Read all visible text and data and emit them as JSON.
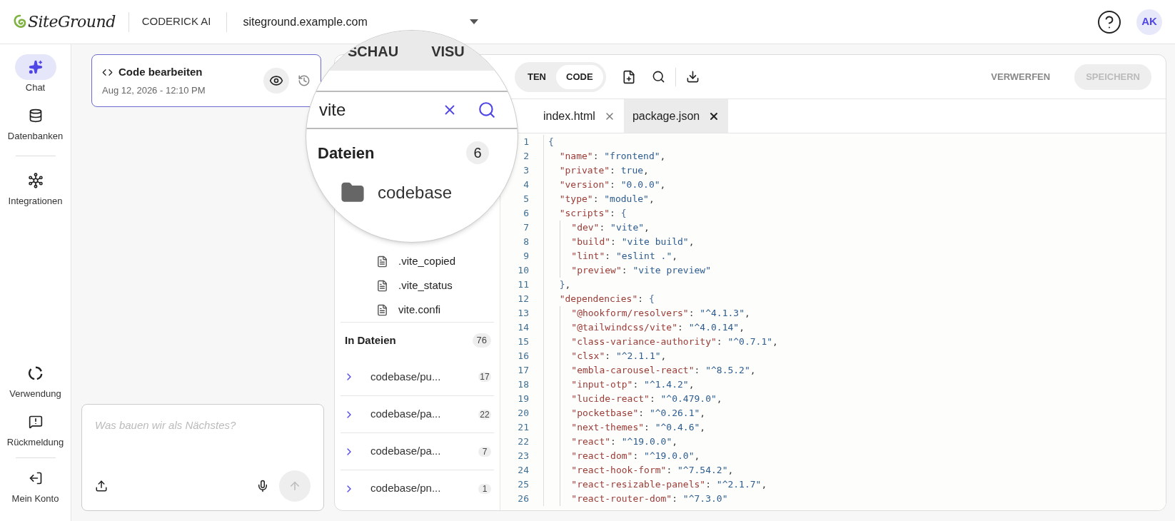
{
  "header": {
    "logo": "SiteGround",
    "product": "CODERICK AI",
    "site_selector": {
      "value": "siteground.example.com"
    },
    "avatar": "AK"
  },
  "nav": {
    "top": [
      {
        "label": "Chat",
        "selected": true
      },
      {
        "label": "Datenbanken",
        "selected": false
      },
      {
        "label": "Integrationen",
        "selected": false
      }
    ],
    "bottom": [
      {
        "label": "Verwendung",
        "selected": false
      },
      {
        "label": "Rückmeldung",
        "selected": false
      },
      {
        "label": "Mein Konto",
        "selected": false
      }
    ]
  },
  "chat": {
    "history": [
      {
        "title": "Code bearbeiten",
        "date": "Aug 12, 2026 - 12:10 PM",
        "selected": true
      }
    ],
    "prompt": {
      "placeholder": "Was bauen wir als Nächstes?"
    }
  },
  "files": {
    "file_items": [
      ".vite_copied",
      ".vite_status",
      "vite.confi"
    ],
    "in_files": {
      "title": "In Dateien",
      "count": "76",
      "results": [
        {
          "path": "codebase/pu...",
          "count": "17"
        },
        {
          "path": "codebase/pa...",
          "count": "22"
        },
        {
          "path": "codebase/pa...",
          "count": "7"
        },
        {
          "path": "codebase/pn...",
          "count": "1"
        }
      ]
    }
  },
  "magnifier": {
    "tabs": [
      {
        "label": "SCHAU",
        "selected": false
      },
      {
        "label": "VISU",
        "selected": false
      }
    ],
    "search": {
      "value": "vite"
    },
    "files_title": "Dateien",
    "files_count": "6",
    "folder": "codebase"
  },
  "editor": {
    "mode_toggle": [
      {
        "label": "TEN",
        "selected": false
      },
      {
        "label": "CODE",
        "selected": true
      }
    ],
    "discard": "VERWERFEN",
    "save": {
      "label": "SPEICHERN",
      "disabled": true
    },
    "tabs": [
      {
        "label": "index.html",
        "selected": false
      },
      {
        "label": "package.json",
        "selected": true
      }
    ],
    "lines": [
      {
        "n": "1",
        "code": "{"
      },
      {
        "n": "2",
        "code": "  \"name\": \"frontend\","
      },
      {
        "n": "3",
        "code": "  \"private\": true,"
      },
      {
        "n": "4",
        "code": "  \"version\": \"0.0.0\","
      },
      {
        "n": "5",
        "code": "  \"type\": \"module\","
      },
      {
        "n": "6",
        "code": "  \"scripts\": {"
      },
      {
        "n": "7",
        "code": "    \"dev\": \"vite\","
      },
      {
        "n": "8",
        "code": "    \"build\": \"vite build\","
      },
      {
        "n": "9",
        "code": "    \"lint\": \"eslint .\","
      },
      {
        "n": "10",
        "code": "    \"preview\": \"vite preview\""
      },
      {
        "n": "11",
        "code": "  },"
      },
      {
        "n": "12",
        "code": "  \"dependencies\": {"
      },
      {
        "n": "13",
        "code": "    \"@hookform/resolvers\": \"^4.1.3\","
      },
      {
        "n": "14",
        "code": "    \"@tailwindcss/vite\": \"^4.0.14\","
      },
      {
        "n": "15",
        "code": "    \"class-variance-authority\": \"^0.7.1\","
      },
      {
        "n": "16",
        "code": "    \"clsx\": \"^2.1.1\","
      },
      {
        "n": "17",
        "code": "    \"embla-carousel-react\": \"^8.5.2\","
      },
      {
        "n": "18",
        "code": "    \"input-otp\": \"^1.4.2\","
      },
      {
        "n": "19",
        "code": "    \"lucide-react\": \"^0.479.0\","
      },
      {
        "n": "20",
        "code": "    \"pocketbase\": \"^0.26.1\","
      },
      {
        "n": "21",
        "code": "    \"next-themes\": \"^0.4.6\","
      },
      {
        "n": "22",
        "code": "    \"react\": \"^19.0.0\","
      },
      {
        "n": "23",
        "code": "    \"react-dom\": \"^19.0.0\","
      },
      {
        "n": "24",
        "code": "    \"react-hook-form\": \"^7.54.2\","
      },
      {
        "n": "25",
        "code": "    \"react-resizable-panels\": \"^2.1.7\","
      },
      {
        "n": "26",
        "code": "    \"react-router-dom\": \"^7.3.0\""
      }
    ]
  }
}
